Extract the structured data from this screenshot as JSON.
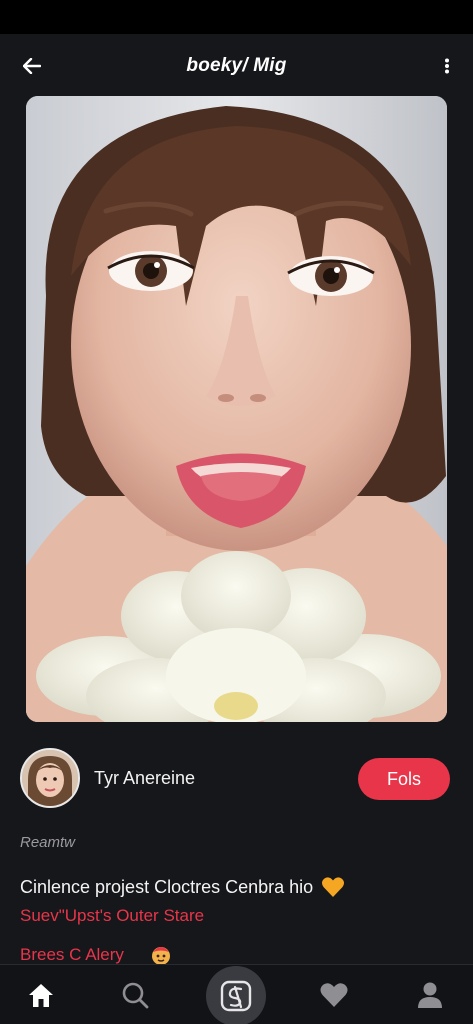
{
  "header": {
    "title": "boeky/ Mig"
  },
  "creator": {
    "name": "Tyr Anereine",
    "follow_label": "Fols"
  },
  "post": {
    "subtitle": "Reamtw",
    "caption": "Cinlence projest Cloctres Cenbra hio",
    "tag_line": "Suev\"Upst's Outer Stare",
    "tag_line_2": "Brees C Alery"
  },
  "icons": {
    "back": "back-arrow-icon",
    "more": "more-vertical-icon",
    "caption_emoji": "orange-heart-icon",
    "tag_emoji": "red-face-icon",
    "tabs": [
      "home-icon",
      "search-icon",
      "create-icon",
      "heart-icon",
      "profile-icon"
    ]
  },
  "colors": {
    "background": "#16171b",
    "accent": "#e8354a",
    "tabbar": "#121317"
  }
}
